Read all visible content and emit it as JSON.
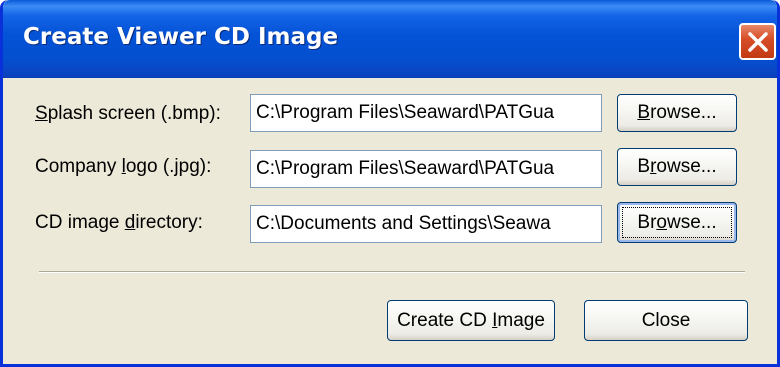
{
  "window": {
    "title": "Create Viewer CD Image"
  },
  "fields": [
    {
      "label_pre": "",
      "label_mnemonic": "S",
      "label_post": "plash screen (.bmp):",
      "value": "C:\\Program Files\\Seaward\\PATGua",
      "browse_pre": "",
      "browse_mnemonic": "B",
      "browse_post": "rowse..."
    },
    {
      "label_pre": "Company ",
      "label_mnemonic": "l",
      "label_post": "ogo (.jpg):",
      "value": "C:\\Program Files\\Seaward\\PATGua",
      "browse_pre": "B",
      "browse_mnemonic": "r",
      "browse_post": "owse..."
    },
    {
      "label_pre": "CD image ",
      "label_mnemonic": "d",
      "label_post": "irectory:",
      "value": "C:\\Documents and Settings\\Seawa",
      "browse_pre": "Br",
      "browse_mnemonic": "o",
      "browse_post": "wse..."
    }
  ],
  "footer": {
    "create_pre": "Create CD ",
    "create_mnemonic": "I",
    "create_post": "mage",
    "close_label": "Close"
  },
  "colors": {
    "titlebar": "#0452d6",
    "window_face": "#ece9d8",
    "close_button": "#d8502a"
  }
}
